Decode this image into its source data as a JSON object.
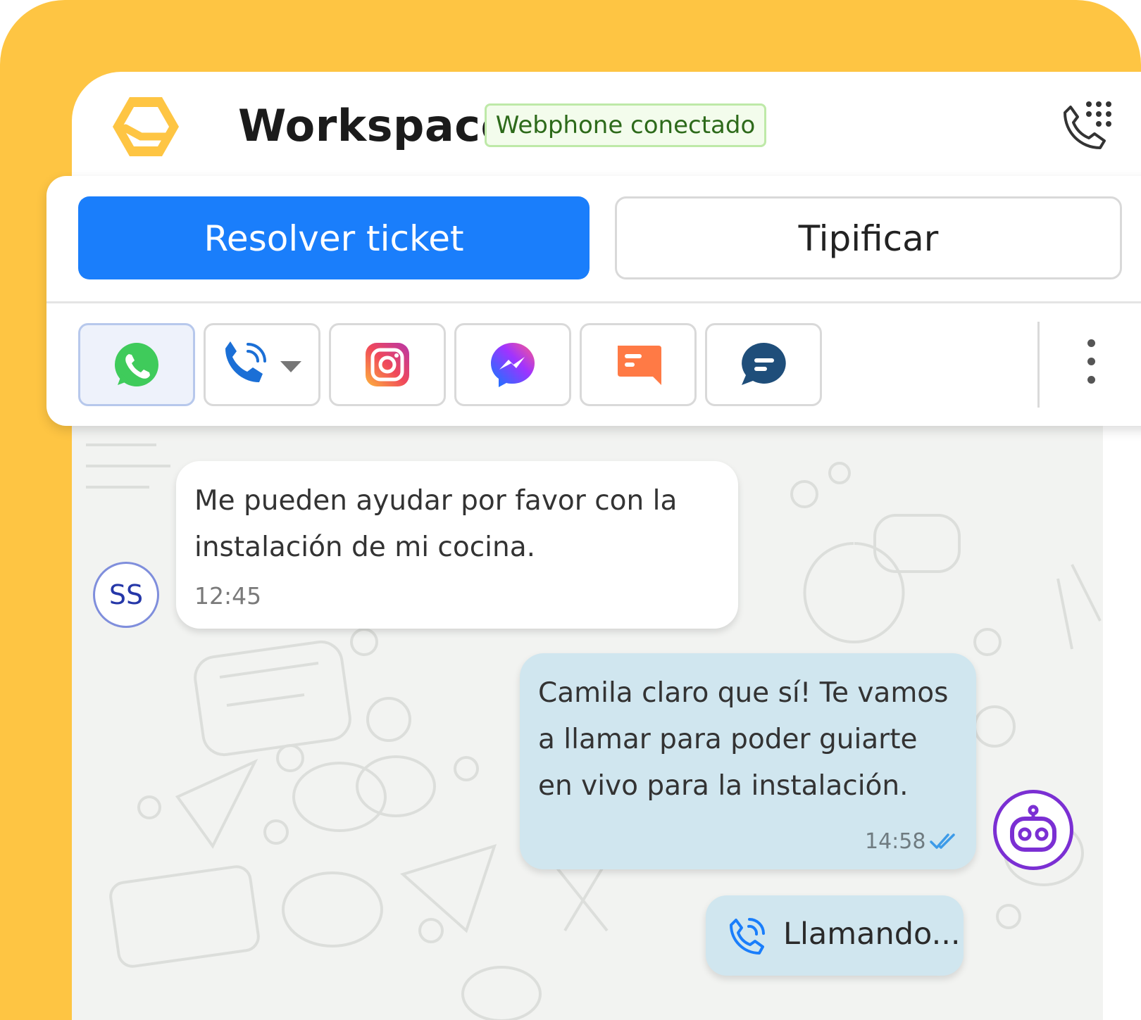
{
  "header": {
    "logo_icon": "workspace-logo-icon",
    "title": "Workspace",
    "status_badge": "Webphone conectado",
    "dialpad_icon": "phone-dialpad-icon"
  },
  "actions": {
    "resolve_label": "Resolver ticket",
    "classify_label": "Tipificar"
  },
  "channels": [
    {
      "icon": "whatsapp-icon",
      "active": true
    },
    {
      "icon": "phone-call-icon",
      "dropdown": true
    },
    {
      "icon": "instagram-icon"
    },
    {
      "icon": "messenger-icon"
    },
    {
      "icon": "sms-icon"
    },
    {
      "icon": "webchat-icon"
    }
  ],
  "messages": {
    "incoming": {
      "avatar": "SS",
      "text": "Me pueden ayudar por favor con la instalación de mi cocina.",
      "time": "12:45"
    },
    "outgoing": {
      "text": "Camila claro que sí! Te vamos a llamar para poder guiarte en vivo para la instalación.",
      "time": "14:58",
      "status_icon": "double-check-icon",
      "avatar_icon": "bot-icon"
    },
    "call": {
      "icon": "phone-call-icon",
      "text": "Llamando..."
    }
  },
  "colors": {
    "frame_bg": "#FEC543",
    "primary": "#1A7EFB",
    "outgoing_bubble": "#D0E6EF",
    "chat_bg": "#F2F3F1",
    "badge_border": "#BEE9A8",
    "bot_purple": "#7B2FD3"
  }
}
